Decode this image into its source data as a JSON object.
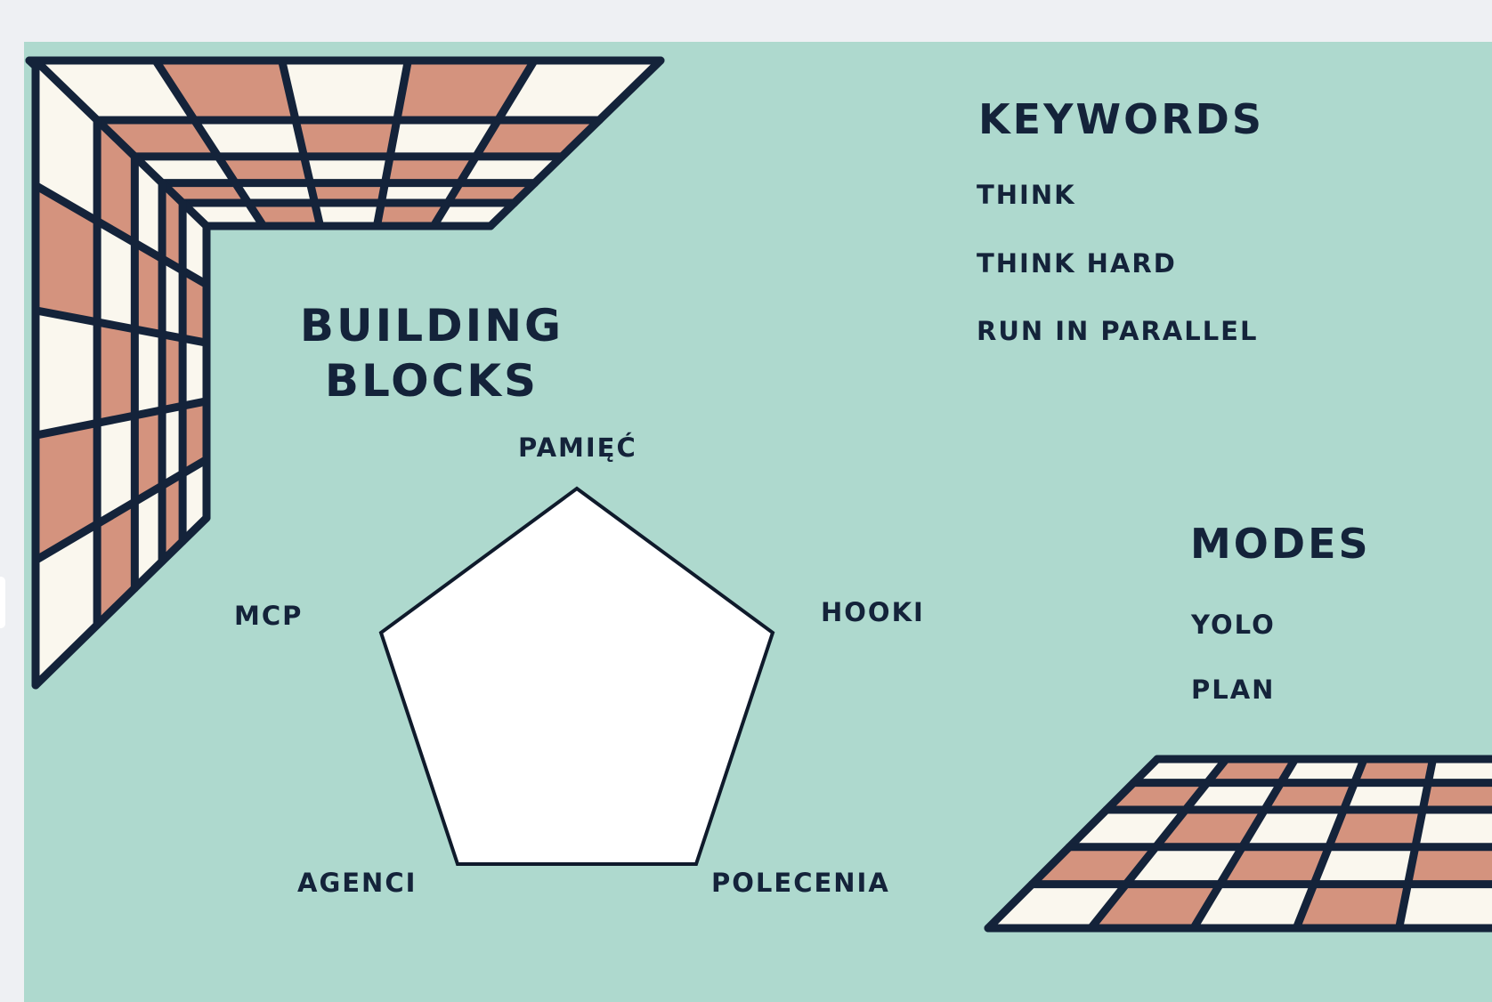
{
  "title": {
    "line1": "BUILDING",
    "line2": "BLOCKS"
  },
  "pentagon": {
    "labels": {
      "top": "PAMIĘĆ",
      "right": "HOOKI",
      "bottom_right": "POLECENIA",
      "bottom_left": "AGENCI",
      "left": "MCP"
    }
  },
  "keywords": {
    "heading": "KEYWORDS",
    "items": [
      "THINK",
      "THINK HARD",
      "RUN IN PARALLEL"
    ]
  },
  "modes": {
    "heading": "MODES",
    "items": [
      "YOLO",
      "PLAN"
    ]
  },
  "colors": {
    "background": "#aed9ce",
    "navy": "#14233a",
    "terracotta": "#d4937e",
    "cream": "#faf7ee",
    "page": "#eef0f3"
  }
}
